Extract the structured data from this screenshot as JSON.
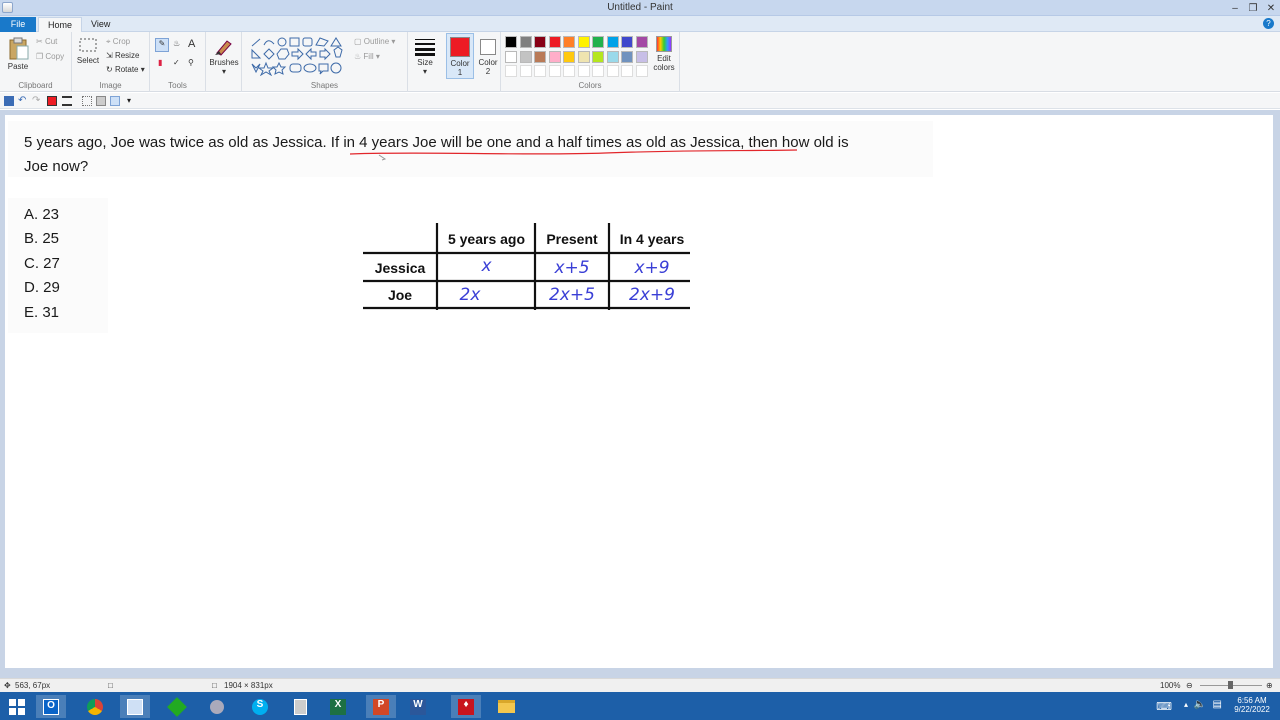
{
  "window": {
    "title": "Untitled - Paint"
  },
  "tabs": {
    "file": "File",
    "home": "Home",
    "view": "View"
  },
  "ribbon": {
    "clipboard": {
      "paste": "Paste",
      "cut": "Cut",
      "copy": "Copy",
      "label": "Clipboard"
    },
    "image": {
      "select": "Select",
      "crop": "Crop",
      "resize": "Resize",
      "rotate": "Rotate",
      "label": "Image"
    },
    "tools": {
      "label": "Tools"
    },
    "brushes": {
      "label": "Brushes"
    },
    "shapes": {
      "outline": "Outline",
      "fill": "Fill",
      "label": "Shapes"
    },
    "size": {
      "label": "Size"
    },
    "color1": {
      "label": "Color",
      "num": "1",
      "value": "#ed1c24"
    },
    "color2": {
      "label": "Color",
      "num": "2",
      "value": "#ffffff"
    },
    "colors": {
      "label": "Colors",
      "edit_label_1": "Edit",
      "edit_label_2": "colors",
      "row1": [
        "#000000",
        "#7f7f7f",
        "#880015",
        "#ed1c24",
        "#ff7f27",
        "#fff200",
        "#22b14c",
        "#00a2e8",
        "#3f48cc",
        "#a349a4"
      ],
      "row2": [
        "#ffffff",
        "#c3c3c3",
        "#b97a57",
        "#ffaec9",
        "#ffc90e",
        "#efe4b0",
        "#b5e61d",
        "#99d9ea",
        "#7092be",
        "#c8bfe7"
      ]
    }
  },
  "document": {
    "question_line1": "5 years ago, Joe was twice as old as Jessica. If in 4 years Joe will be one and a half times as old as Jessica, then how old is",
    "question_line2": "Joe now?",
    "choices": [
      "A. 23",
      "B. 25",
      "C. 27",
      "D. 29",
      "E. 31"
    ],
    "table": {
      "headers": [
        "5 years ago",
        "Present",
        "In 4 years"
      ],
      "rows": [
        {
          "label": "Jessica",
          "cells": [
            "x",
            "x+5",
            "x+9"
          ]
        },
        {
          "label": "Joe",
          "cells": [
            "2x",
            "2x+5",
            "2x+9"
          ]
        }
      ]
    }
  },
  "statusbar": {
    "cursor": "563, 67px",
    "dimensions": "1904 × 831px",
    "zoom": "100%"
  },
  "taskbar": {
    "time": "6:56 AM",
    "date": "9/22/2022"
  }
}
